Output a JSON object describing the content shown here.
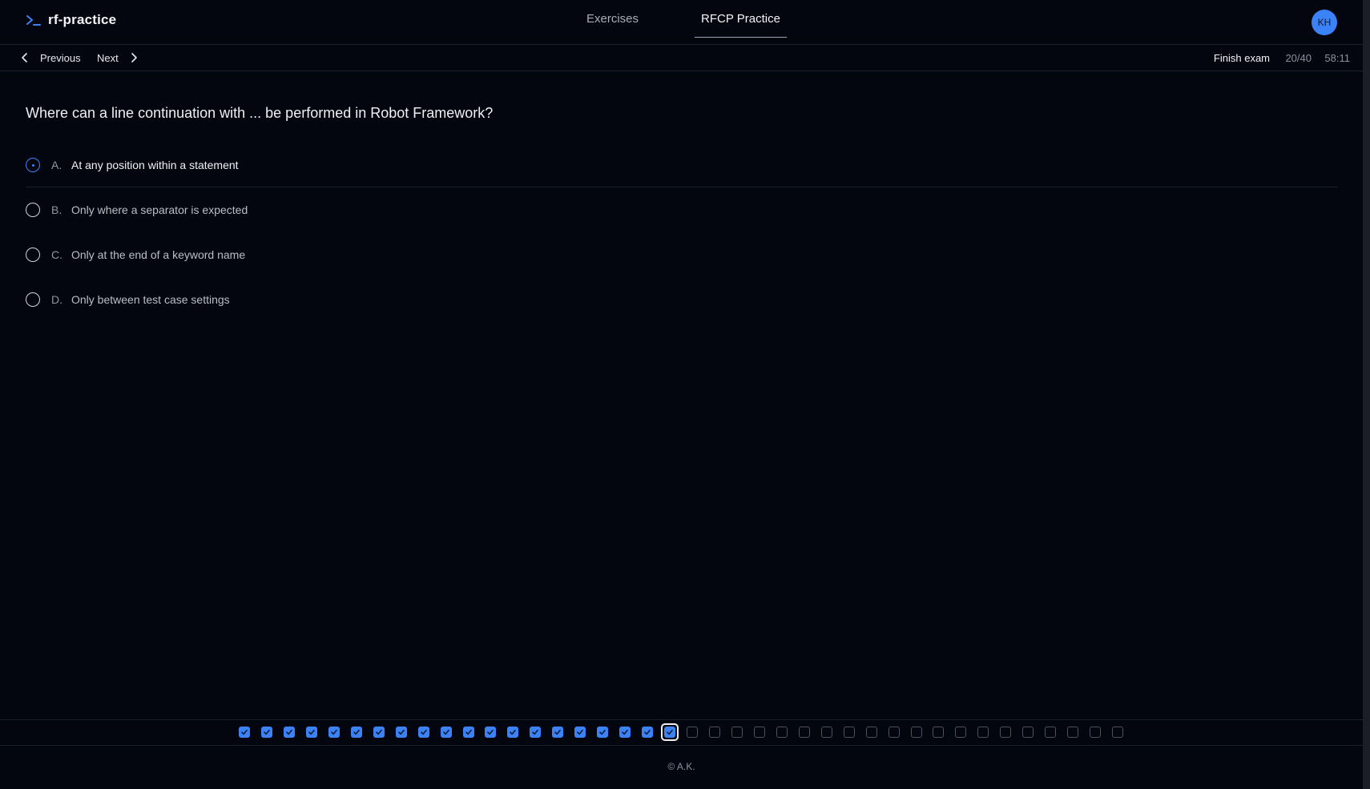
{
  "header": {
    "brand_name": "rf-practice",
    "tabs": [
      {
        "label": "Exercises",
        "active": false
      },
      {
        "label": "RFCP Practice",
        "active": true
      }
    ],
    "avatar_initials": "KH"
  },
  "toolbar": {
    "previous_label": "Previous",
    "next_label": "Next",
    "finish_label": "Finish exam",
    "progress": "20/40",
    "timer": "58:11"
  },
  "question": {
    "text": "Where can a line continuation with ... be performed in Robot Framework?",
    "options": [
      {
        "letter": "A.",
        "text": "At any position within a statement",
        "selected": true
      },
      {
        "letter": "B.",
        "text": "Only where a separator is expected",
        "selected": false
      },
      {
        "letter": "C.",
        "text": "Only at the end of a keyword name",
        "selected": false
      },
      {
        "letter": "D.",
        "text": "Only between test case settings",
        "selected": false
      }
    ]
  },
  "question_nav": {
    "total": 40,
    "answered_count": 20,
    "current": 20
  },
  "footer": {
    "text": "© A.K."
  },
  "colors": {
    "accent": "#3b82f6",
    "background": "#03060f",
    "border": "#1c2130"
  }
}
